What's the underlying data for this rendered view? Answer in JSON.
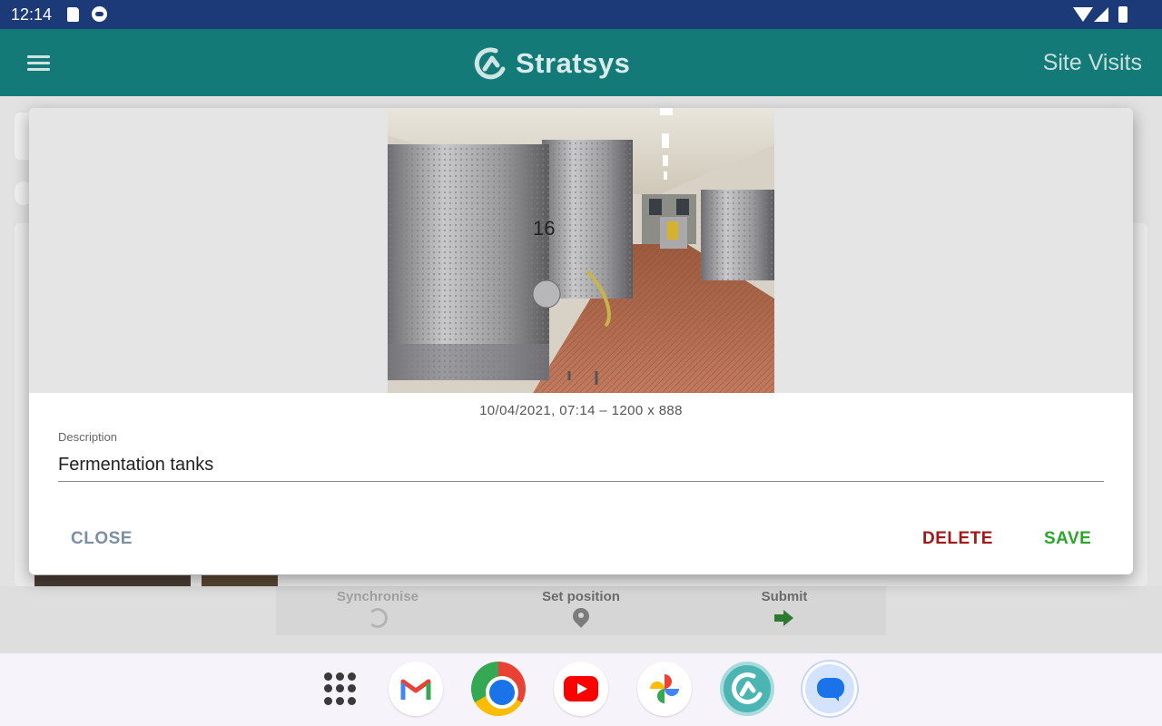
{
  "status_bar": {
    "time": "12:14"
  },
  "app_bar": {
    "brand": "Stratsys",
    "title": "Site Visits"
  },
  "bottom_actions": {
    "synchronise": "Synchronise",
    "set_position": "Set position",
    "submit": "Submit"
  },
  "dialog": {
    "photo_meta": "10/04/2021, 07:14 – 1200 x 888",
    "description_label": "Description",
    "description_value": "Fermentation tanks",
    "close_label": "CLOSE",
    "delete_label": "DELETE",
    "save_label": "SAVE"
  },
  "dock": {
    "apps": [
      "app-drawer-icon",
      "gmail-icon",
      "chrome-icon",
      "youtube-icon",
      "photos-icon",
      "stratsys-icon",
      "messages-icon"
    ]
  },
  "colors": {
    "status_bar": "#1d3a78",
    "app_bar": "#137a78",
    "delete": "#a11818",
    "save": "#2aa62a",
    "close": "#7a8fa3"
  }
}
